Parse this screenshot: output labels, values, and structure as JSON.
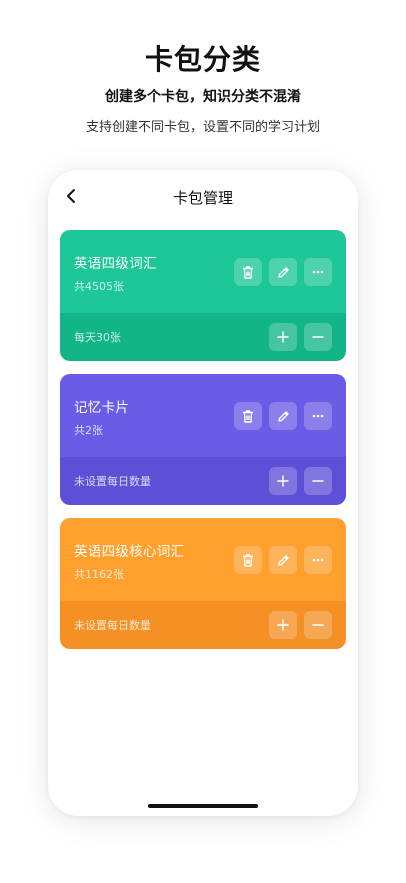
{
  "promo": {
    "headline": "卡包分类",
    "subheadline": "创建多个卡包，知识分类不混淆",
    "description": "支持创建不同卡包，设置不同的学习计划"
  },
  "navbar": {
    "title": "卡包管理"
  },
  "cards": [
    {
      "name": "英语四级词汇",
      "count": "共4505张",
      "daily": "每天30张",
      "color": "#1DC797",
      "bottom_color": "#12B586"
    },
    {
      "name": "记忆卡片",
      "count": "共2张",
      "daily": "未设置每日数量",
      "color": "#6B5CE7",
      "bottom_color": "#5E50D6"
    },
    {
      "name": "英语四级核心词汇",
      "count": "共1162张",
      "daily": "未设置每日数量",
      "color": "#FF9F2D",
      "bottom_color": "#F59025"
    }
  ],
  "icons": {
    "back": "chevron-left-icon",
    "delete": "trash-icon",
    "edit": "pencil-icon",
    "more": "more-dots-icon",
    "increase": "plus-icon",
    "decrease": "minus-icon"
  }
}
